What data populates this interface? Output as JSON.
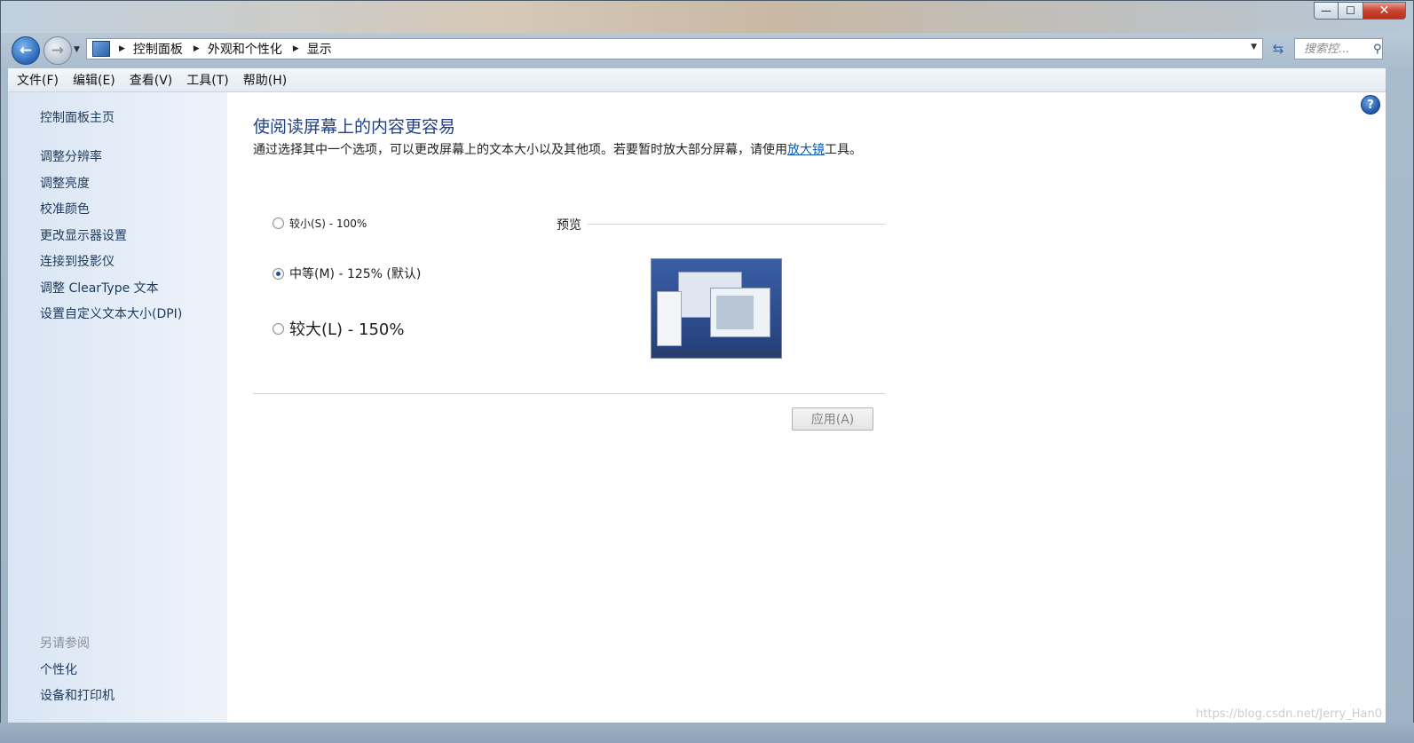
{
  "window": {
    "caption_min": "—",
    "caption_max": "☐",
    "caption_close": "✕"
  },
  "nav": {
    "back_glyph": "←",
    "forward_glyph": "→",
    "breadcrumb": [
      "控制面板",
      "外观和个性化",
      "显示"
    ],
    "refresh_glyph": "⇆",
    "search_placeholder": "搜索控..."
  },
  "menubar": {
    "items": [
      "文件(F)",
      "编辑(E)",
      "查看(V)",
      "工具(T)",
      "帮助(H)"
    ]
  },
  "sidebar": {
    "home": "控制面板主页",
    "links": [
      "调整分辨率",
      "调整亮度",
      "校准颜色",
      "更改显示器设置",
      "连接到投影仪",
      "调整 ClearType 文本",
      "设置自定义文本大小(DPI)"
    ],
    "see_also_heading": "另请参阅",
    "see_also": [
      "个性化",
      "设备和打印机"
    ]
  },
  "main": {
    "title": "使阅读屏幕上的内容更容易",
    "description_before": "通过选择其中一个选项，可以更改屏幕上的文本大小以及其他项。若要暂时放大部分屏幕，请使用",
    "description_link": "放大镜",
    "description_after": "工具。",
    "options": [
      {
        "label": "较小(S) - 100%",
        "checked": false
      },
      {
        "label": "中等(M) - 125% (默认)",
        "checked": true
      },
      {
        "label": "较大(L) - 150%",
        "checked": false
      }
    ],
    "preview_label": "预览",
    "apply_label": "应用(A)",
    "help_glyph": "?"
  },
  "watermark": "https://blog.csdn.net/Jerry_Han0"
}
